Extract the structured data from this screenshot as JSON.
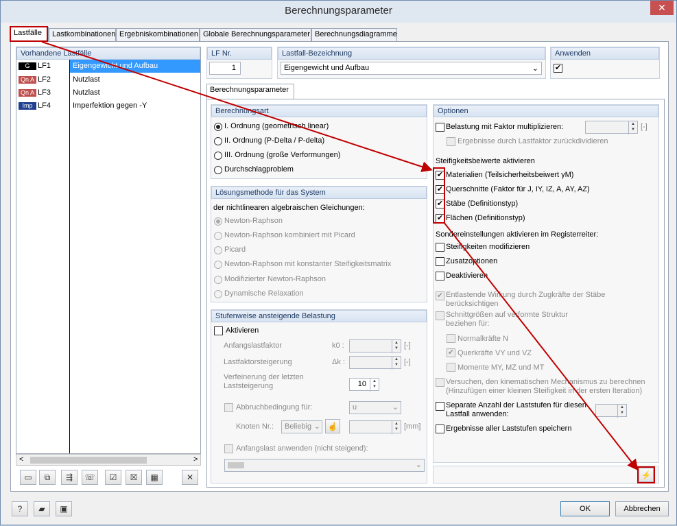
{
  "window": {
    "title": "Berechnungsparameter",
    "close_glyph": "✕"
  },
  "tabs": [
    "Lastfälle",
    "Lastkombinationen",
    "Ergebniskombinationen",
    "Globale Berechnungsparameter",
    "Berechnungsdiagramme"
  ],
  "left": {
    "header": "Vorhandene Lastfälle",
    "items": [
      {
        "badge": "G",
        "badge_color": "#000000",
        "id": "LF1",
        "name": "Eigengewicht und Aufbau"
      },
      {
        "badge": "Qn A",
        "badge_color": "#c0504d",
        "id": "LF2",
        "name": "Nutzlast"
      },
      {
        "badge": "Qn A",
        "badge_color": "#c0504d",
        "id": "LF3",
        "name": "Nutzlast"
      },
      {
        "badge": "Imp",
        "badge_color": "#1f3f8f",
        "id": "LF4",
        "name": "Imperfektion gegen -Y"
      }
    ],
    "scroll_left": "<",
    "scroll_right": ">"
  },
  "top": {
    "lf_nr_label": "LF Nr.",
    "lf_nr_value": "1",
    "bez_label": "Lastfall-Bezeichnung",
    "bez_value": "Eigengewicht und Aufbau",
    "anwenden_label": "Anwenden"
  },
  "inner_tab": "Berechnungsparameter",
  "berechnungsart": {
    "title": "Berechnungsart",
    "options": [
      "I. Ordnung (geometrisch linear)",
      "II. Ordnung (P-Delta / P-delta)",
      "III. Ordnung (große Verformungen)",
      "Durchschlagproblem"
    ]
  },
  "loesung": {
    "title": "Lösungsmethode für das System",
    "subtitle": "der nichtlinearen algebraischen Gleichungen:",
    "options": [
      "Newton-Raphson",
      "Newton-Raphson kombiniert mit Picard",
      "Picard",
      "Newton-Raphson mit konstanter Steifigkeitsmatrix",
      "Modifizierter Newton-Raphson",
      "Dynamische Relaxation"
    ]
  },
  "stufen": {
    "title": "Stufenweise ansteigende Belastung",
    "aktivieren": "Aktivieren",
    "anfangslastfaktor": "Anfangslastfaktor",
    "k0": "k0 :",
    "steigerung": "Lastfaktorsteigerung",
    "dk": "Δk :",
    "verfeinerung_1": "Verfeinerung der letzten",
    "verfeinerung_2": "Laststeigerung",
    "verfeinerung_value": "10",
    "abbruch": "Abbruchbedingung für:",
    "abbruch_value": "u",
    "knoten": "Knoten Nr.:",
    "knoten_value": "Beliebig",
    "mm": "[mm]",
    "unit": "[-]",
    "anfangslast": "Anfangslast anwenden (nicht steigend):"
  },
  "optionen": {
    "title": "Optionen",
    "belastung": "Belastung mit Faktor multiplizieren:",
    "unit": "[-]",
    "zurueck": "Ergebnisse durch Lastfaktor zurückdividieren",
    "steif_title": "Steifigkeitsbeiwerte aktivieren",
    "steif": [
      "Materialien (Teilsicherheitsbeiwert γM)",
      "Querschnitte (Faktor für J, IY, IZ, A, AY, AZ)",
      "Stäbe (Definitionstyp)",
      "Flächen (Definitionstyp)"
    ],
    "sonder_title": "Sondereinstellungen aktivieren im Registerreiter:",
    "sonder": [
      "Steifigkeiten modifizieren",
      "Zusatzoptionen",
      "Deaktivieren"
    ],
    "entlastend_1": "Entlastende Wirkung durch Zugkräfte der Stäbe",
    "entlastend_2": "berücksichtigen",
    "schnitt_1": "Schnittgrößen auf verformte Struktur",
    "schnitt_2": "beziehen für:",
    "normal": "Normalkräfte N",
    "quer": "Querkräfte VY und VZ",
    "momente": "Momente MY, MZ und MT",
    "kinem_1": "Versuchen, den kinematischen Mechanismus zu berechnen",
    "kinem_2": "(Hinzufügen einer kleinen Steifigkeit in der ersten Iteration)",
    "separate_1": "Separate Anzahl der Laststufen für diesen",
    "separate_2": "Lastfall anwenden:",
    "alle": "Ergebnisse aller Laststufen speichern"
  },
  "buttons": {
    "ok": "OK",
    "abbrechen": "Abbrechen"
  },
  "colors": {
    "selection": "#3399ff",
    "annotation_red": "#c00000"
  }
}
